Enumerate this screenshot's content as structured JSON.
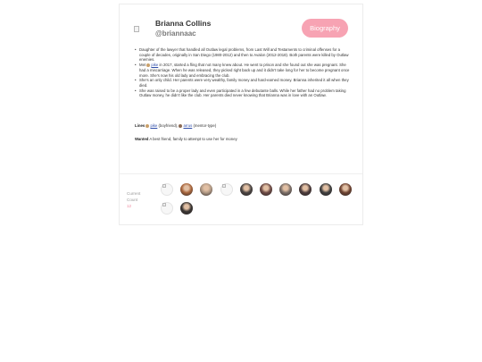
{
  "profile": {
    "name": "Brianna Collins",
    "handle": "@briannaac",
    "biography_button": "Biography"
  },
  "bio": {
    "items": [
      "Daughter of the lawyer that handled all Outlaw legal problems, from Last Will and Testaments to criminal offenses for a couple of decades, originally in San Diego (1980-2012) and then to Avalon (2012-2018). Both parents were killed by Outlaw enemies.",
      "Met",
      "in 2017, started a fling that not many knew about. He went to prison and she found out she was pregnant. She had a miscarriage. When he was released, they picked right back up and it didn't take long for her to become pregnant once more. She's now his old lady and embracing the club.",
      "She's an only child. Her parents were very wealthy, family money and hard-earned money. Brianna inherited it all when they died.",
      "She was raised to be a proper lady and even participated in a few debutante balls. While her father had no problem taking Outlaw money, he didn't like the club. Her parents died never knowing that Brianna was in love with an Outlaw."
    ],
    "met_link": "pike"
  },
  "lines": {
    "label": "Lines",
    "link1": "pike",
    "rel1": "(boyfriend),",
    "link2": "arrus",
    "rel2": "(mentor-type)"
  },
  "wanted": {
    "label": "Wanted",
    "text": "A best friend, family to attempt to use her for money"
  },
  "current": {
    "label": "Current Count",
    "value": "12"
  },
  "avatars": [
    {
      "name": "avatar-1",
      "image": false
    },
    {
      "name": "avatar-2",
      "image": true,
      "color": "#a9663d"
    },
    {
      "name": "avatar-3",
      "image": true,
      "color": "#b29a86"
    },
    {
      "name": "avatar-4",
      "image": false
    },
    {
      "name": "avatar-5",
      "image": true,
      "color": "#4a4442"
    },
    {
      "name": "avatar-6",
      "image": true,
      "color": "#6d4a45"
    },
    {
      "name": "avatar-7",
      "image": true,
      "color": "#7d7069"
    },
    {
      "name": "avatar-8",
      "image": true,
      "color": "#4b3b3b"
    },
    {
      "name": "avatar-9",
      "image": true,
      "color": "#3f3f3f"
    },
    {
      "name": "avatar-10",
      "image": true,
      "color": "#6e4331"
    },
    {
      "name": "avatar-11",
      "image": false
    },
    {
      "name": "avatar-12",
      "image": true,
      "color": "#3a3533"
    }
  ],
  "colors": {
    "accent": "#f7a3b3",
    "count": "#f08aa0",
    "link": "#2d4ca8"
  }
}
